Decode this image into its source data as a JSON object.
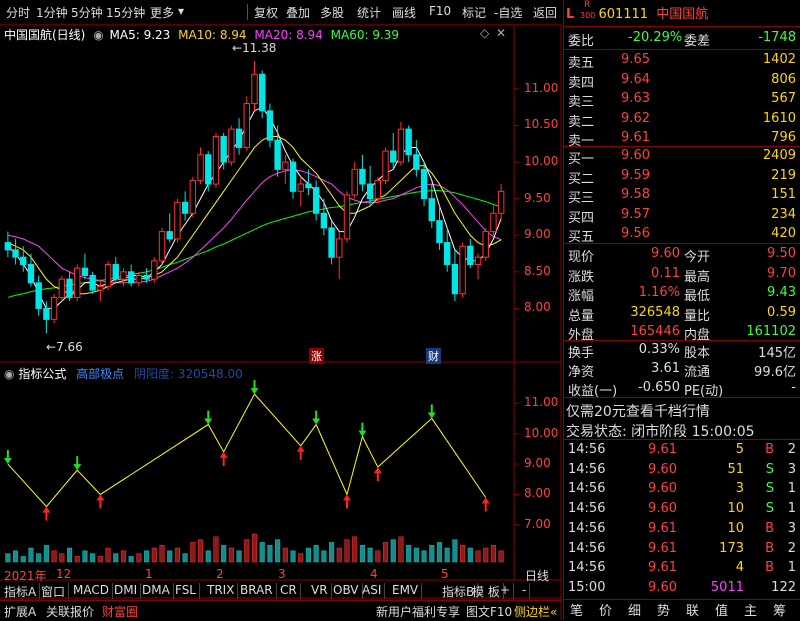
{
  "toolbar": {
    "left": [
      "分时",
      "1分钟",
      "5分钟",
      "15分钟",
      "更多"
    ],
    "right": [
      "复权",
      "叠加",
      "多股",
      "统计",
      "画线",
      "F10",
      "标记",
      "-自选",
      "返回"
    ]
  },
  "chart_header": {
    "name": "中国国航(日线)",
    "ma5": "MA5: 9.23",
    "ma10": "MA10: 8.94",
    "ma20": "MA20: 8.94",
    "ma60": "MA60: 9.39",
    "high_label": "11.38",
    "low_label": "7.66",
    "marker_up": "涨",
    "marker_fin": "财"
  },
  "price_axis": [
    "11.00",
    "10.50",
    "10.00",
    "9.50",
    "9.00",
    "8.50",
    "8.00"
  ],
  "indicator_header": {
    "title": "指标公式",
    "name": "高部极点",
    "value_label": "阴阳度: 320548.00"
  },
  "indicator_axis": [
    "11.00",
    "10.00",
    "9.00",
    "8.00",
    "7.00"
  ],
  "date_axis": [
    "2021年",
    "12",
    "1",
    "2",
    "3",
    "4",
    "5"
  ],
  "date_axis_right": "日线",
  "indicator_tabs": [
    "指标A",
    "窗口",
    "MACD",
    "DMI",
    "DMA",
    "FSL",
    "TRIX",
    "BRAR",
    "CR",
    "VR",
    "OBV",
    "ASI",
    "EMV",
    "指标B",
    "模 板",
    "+",
    "-"
  ],
  "bottom_tabs": [
    "扩展A",
    "关联报价",
    "财富圈"
  ],
  "bottom_ad": "新用户福利专享",
  "bottom_f10": "图文F10",
  "bottom_side": "侧边栏",
  "quote": {
    "code": "601111",
    "name": "中国国航",
    "badge_l": "L",
    "badge_r": "R",
    "badge_300": "300",
    "wei_bi_label": "委比",
    "wei_bi": "-20.29%",
    "wei_cha_label": "委差",
    "wei_cha": "-1748",
    "sells": [
      {
        "label": "卖五",
        "price": "9.65",
        "vol": "1402"
      },
      {
        "label": "卖四",
        "price": "9.64",
        "vol": "806"
      },
      {
        "label": "卖三",
        "price": "9.63",
        "vol": "567"
      },
      {
        "label": "卖二",
        "price": "9.62",
        "vol": "1610"
      },
      {
        "label": "卖一",
        "price": "9.61",
        "vol": "796"
      }
    ],
    "buys": [
      {
        "label": "买一",
        "price": "9.60",
        "vol": "2409"
      },
      {
        "label": "买二",
        "price": "9.59",
        "vol": "219"
      },
      {
        "label": "买三",
        "price": "9.58",
        "vol": "151"
      },
      {
        "label": "买四",
        "price": "9.57",
        "vol": "234"
      },
      {
        "label": "买五",
        "price": "9.56",
        "vol": "420"
      }
    ],
    "stats": [
      {
        "l1": "现价",
        "v1": "9.60",
        "l2": "今开",
        "v2": "9.50"
      },
      {
        "l1": "涨跌",
        "v1": "0.11",
        "l2": "最高",
        "v2": "9.70"
      },
      {
        "l1": "涨幅",
        "v1": "1.16%",
        "l2": "最低",
        "v2": "9.43"
      },
      {
        "l1": "总量",
        "v1": "326548",
        "l2": "量比",
        "v2": "0.59"
      },
      {
        "l1": "外盘",
        "v1": "165446",
        "l2": "内盘",
        "v2": "161102"
      }
    ],
    "stats2": [
      {
        "l1": "换手",
        "v1": "0.33%",
        "l2": "股本",
        "v2": "145亿"
      },
      {
        "l1": "净资",
        "v1": "3.61",
        "l2": "流通",
        "v2": "99.6亿"
      },
      {
        "l1": "收益(一)",
        "v1": "-0.650",
        "l2": "PE(动)",
        "v2": "-"
      }
    ],
    "promo": "仅需20元查看千档行情",
    "trade_status_label": "交易状态:",
    "trade_status": "闭市阶段",
    "trade_time": "15:00:05",
    "ticks": [
      {
        "t": "14:56",
        "p": "9.61",
        "v": "5",
        "d": "B",
        "n": "2"
      },
      {
        "t": "14:56",
        "p": "9.60",
        "v": "51",
        "d": "S",
        "n": "3"
      },
      {
        "t": "14:56",
        "p": "9.60",
        "v": "3",
        "d": "S",
        "n": "1"
      },
      {
        "t": "14:56",
        "p": "9.60",
        "v": "10",
        "d": "S",
        "n": "1"
      },
      {
        "t": "14:56",
        "p": "9.61",
        "v": "10",
        "d": "B",
        "n": "3"
      },
      {
        "t": "14:56",
        "p": "9.61",
        "v": "173",
        "d": "B",
        "n": "2"
      },
      {
        "t": "14:56",
        "p": "9.61",
        "v": "4",
        "d": "B",
        "n": "1"
      },
      {
        "t": "15:00",
        "p": "9.60",
        "v": "5011",
        "d": "",
        "n": "122"
      }
    ],
    "side_buttons": [
      "笔",
      "价",
      "细",
      "势",
      "联",
      "值",
      "主",
      "筹"
    ]
  },
  "chart_data": {
    "type": "candlestick",
    "y_range": [
      7.5,
      11.6
    ],
    "ohlc": [
      [
        8.9,
        9.05,
        8.7,
        8.8
      ],
      [
        8.8,
        8.95,
        8.6,
        8.7
      ],
      [
        8.7,
        8.85,
        8.5,
        8.6
      ],
      [
        8.6,
        8.75,
        8.3,
        8.35
      ],
      [
        8.35,
        8.45,
        7.9,
        8.0
      ],
      [
        8.0,
        8.1,
        7.66,
        7.85
      ],
      [
        7.85,
        8.2,
        7.8,
        8.15
      ],
      [
        8.15,
        8.45,
        8.1,
        8.4
      ],
      [
        8.4,
        8.5,
        8.1,
        8.15
      ],
      [
        8.15,
        8.6,
        8.1,
        8.55
      ],
      [
        8.55,
        8.75,
        8.4,
        8.45
      ],
      [
        8.45,
        8.5,
        8.2,
        8.25
      ],
      [
        8.25,
        8.4,
        8.1,
        8.3
      ],
      [
        8.3,
        8.65,
        8.25,
        8.6
      ],
      [
        8.6,
        8.7,
        8.35,
        8.4
      ],
      [
        8.4,
        8.55,
        8.3,
        8.5
      ],
      [
        8.5,
        8.6,
        8.3,
        8.35
      ],
      [
        8.35,
        8.5,
        8.3,
        8.45
      ],
      [
        8.45,
        8.55,
        8.35,
        8.4
      ],
      [
        8.4,
        8.7,
        8.35,
        8.65
      ],
      [
        8.65,
        9.1,
        8.6,
        9.05
      ],
      [
        9.05,
        9.3,
        8.9,
        8.95
      ],
      [
        8.95,
        9.5,
        8.9,
        9.45
      ],
      [
        9.45,
        9.6,
        9.2,
        9.3
      ],
      [
        9.3,
        9.8,
        9.25,
        9.75
      ],
      [
        9.75,
        10.2,
        9.7,
        10.1
      ],
      [
        10.1,
        10.15,
        9.6,
        9.7
      ],
      [
        9.7,
        10.4,
        9.65,
        10.35
      ],
      [
        10.35,
        10.4,
        9.9,
        10.0
      ],
      [
        10.0,
        10.5,
        9.95,
        10.45
      ],
      [
        10.45,
        10.6,
        10.1,
        10.2
      ],
      [
        10.2,
        10.9,
        10.15,
        10.8
      ],
      [
        10.8,
        11.38,
        10.7,
        11.2
      ],
      [
        11.2,
        11.25,
        10.6,
        10.7
      ],
      [
        10.7,
        10.8,
        10.2,
        10.3
      ],
      [
        10.3,
        10.5,
        9.8,
        9.9
      ],
      [
        9.9,
        10.1,
        9.7,
        10.0
      ],
      [
        10.0,
        10.05,
        9.5,
        9.6
      ],
      [
        9.6,
        9.8,
        9.4,
        9.7
      ],
      [
        9.7,
        9.9,
        9.55,
        9.65
      ],
      [
        9.65,
        9.75,
        9.2,
        9.3
      ],
      [
        9.3,
        9.5,
        9.0,
        9.1
      ],
      [
        9.1,
        9.2,
        8.6,
        8.7
      ],
      [
        8.7,
        9.05,
        8.4,
        8.95
      ],
      [
        8.95,
        9.6,
        8.9,
        9.55
      ],
      [
        9.55,
        10.0,
        9.5,
        9.9
      ],
      [
        9.9,
        10.1,
        9.6,
        9.7
      ],
      [
        9.7,
        9.95,
        9.4,
        9.5
      ],
      [
        9.5,
        9.8,
        9.45,
        9.75
      ],
      [
        9.75,
        10.2,
        9.7,
        10.15
      ],
      [
        10.15,
        10.4,
        9.9,
        10.0
      ],
      [
        10.0,
        10.55,
        9.95,
        10.45
      ],
      [
        10.45,
        10.5,
        10.0,
        10.1
      ],
      [
        10.1,
        10.3,
        9.8,
        9.9
      ],
      [
        9.9,
        10.0,
        9.4,
        9.5
      ],
      [
        9.5,
        9.7,
        9.1,
        9.2
      ],
      [
        9.2,
        9.4,
        8.8,
        8.9
      ],
      [
        8.9,
        9.1,
        8.5,
        8.6
      ],
      [
        8.6,
        8.8,
        8.1,
        8.2
      ],
      [
        8.2,
        8.9,
        8.15,
        8.85
      ],
      [
        8.85,
        8.95,
        8.55,
        8.6
      ],
      [
        8.6,
        8.75,
        8.4,
        8.7
      ],
      [
        8.7,
        9.1,
        8.65,
        9.05
      ],
      [
        9.05,
        9.4,
        9.0,
        9.3
      ],
      [
        9.3,
        9.7,
        9.2,
        9.6
      ]
    ],
    "ma5": [
      8.85,
      8.75,
      8.6,
      8.45,
      8.2,
      8.0,
      8.0,
      8.1,
      8.2,
      8.25,
      8.35,
      8.35,
      8.3,
      8.35,
      8.4,
      8.4,
      8.45,
      8.45,
      8.42,
      8.5,
      8.6,
      8.8,
      9.0,
      9.15,
      9.3,
      9.5,
      9.7,
      9.85,
      10.0,
      10.15,
      10.3,
      10.5,
      10.7,
      10.75,
      10.6,
      10.4,
      10.15,
      9.95,
      9.8,
      9.7,
      9.6,
      9.45,
      9.2,
      9.05,
      9.05,
      9.25,
      9.5,
      9.65,
      9.75,
      9.85,
      9.9,
      10.1,
      10.2,
      10.2,
      10.0,
      9.75,
      9.4,
      9.1,
      8.8,
      8.7,
      8.65,
      8.65,
      8.75,
      8.95,
      9.23
    ],
    "ma10": [
      8.9,
      8.85,
      8.8,
      8.7,
      8.55,
      8.4,
      8.3,
      8.25,
      8.2,
      8.2,
      8.2,
      8.22,
      8.25,
      8.3,
      8.35,
      8.38,
      8.4,
      8.4,
      8.42,
      8.45,
      8.5,
      8.6,
      8.7,
      8.85,
      9.0,
      9.15,
      9.3,
      9.45,
      9.6,
      9.75,
      9.9,
      10.05,
      10.2,
      10.3,
      10.35,
      10.35,
      10.3,
      10.2,
      10.05,
      9.95,
      9.85,
      9.7,
      9.55,
      9.4,
      9.3,
      9.3,
      9.35,
      9.4,
      9.5,
      9.55,
      9.65,
      9.75,
      9.85,
      9.95,
      9.95,
      9.85,
      9.7,
      9.5,
      9.3,
      9.15,
      9.0,
      8.9,
      8.85,
      8.88,
      8.94
    ],
    "ma20": [
      9.0,
      8.98,
      8.95,
      8.9,
      8.85,
      8.75,
      8.65,
      8.55,
      8.5,
      8.45,
      8.42,
      8.4,
      8.38,
      8.36,
      8.35,
      8.35,
      8.35,
      8.36,
      8.37,
      8.4,
      8.45,
      8.5,
      8.55,
      8.62,
      8.7,
      8.8,
      8.9,
      9.0,
      9.1,
      9.22,
      9.35,
      9.48,
      9.6,
      9.72,
      9.8,
      9.85,
      9.88,
      9.9,
      9.88,
      9.85,
      9.8,
      9.75,
      9.7,
      9.6,
      9.52,
      9.48,
      9.45,
      9.45,
      9.45,
      9.48,
      9.5,
      9.55,
      9.6,
      9.65,
      9.68,
      9.7,
      9.68,
      9.62,
      9.52,
      9.42,
      9.3,
      9.18,
      9.06,
      8.98,
      8.94
    ],
    "ma60": [
      8.15,
      8.18,
      8.2,
      8.23,
      8.25,
      8.27,
      8.28,
      8.3,
      8.32,
      8.34,
      8.35,
      8.37,
      8.38,
      8.4,
      8.42,
      8.44,
      8.46,
      8.48,
      8.5,
      8.53,
      8.56,
      8.6,
      8.63,
      8.67,
      8.71,
      8.75,
      8.79,
      8.84,
      8.88,
      8.93,
      8.98,
      9.03,
      9.08,
      9.13,
      9.17,
      9.2,
      9.23,
      9.26,
      9.29,
      9.32,
      9.34,
      9.36,
      9.38,
      9.39,
      9.41,
      9.43,
      9.45,
      9.47,
      9.49,
      9.51,
      9.53,
      9.55,
      9.57,
      9.59,
      9.6,
      9.61,
      9.61,
      9.6,
      9.58,
      9.55,
      9.52,
      9.49,
      9.46,
      9.42,
      9.39
    ],
    "indicator_zigzag": [
      [
        0,
        9.0
      ],
      [
        5,
        7.6
      ],
      [
        9,
        8.8
      ],
      [
        12,
        8.0
      ],
      [
        26,
        10.3
      ],
      [
        28,
        9.4
      ],
      [
        32,
        11.3
      ],
      [
        38,
        9.6
      ],
      [
        40,
        10.3
      ],
      [
        44,
        8.0
      ],
      [
        46,
        9.9
      ],
      [
        48,
        8.9
      ],
      [
        55,
        10.5
      ],
      [
        62,
        7.9
      ]
    ],
    "volume": [
      3,
      4,
      2,
      5,
      3,
      6,
      4,
      3,
      5,
      2,
      4,
      3,
      2,
      5,
      3,
      4,
      2,
      3,
      4,
      5,
      6,
      4,
      5,
      3,
      7,
      8,
      4,
      9,
      6,
      5,
      4,
      8,
      10,
      7,
      6,
      8,
      5,
      4,
      3,
      5,
      6,
      4,
      7,
      5,
      8,
      9,
      6,
      5,
      4,
      7,
      8,
      9,
      6,
      5,
      4,
      6,
      7,
      5,
      8,
      6,
      5,
      4,
      5,
      6,
      4
    ]
  }
}
